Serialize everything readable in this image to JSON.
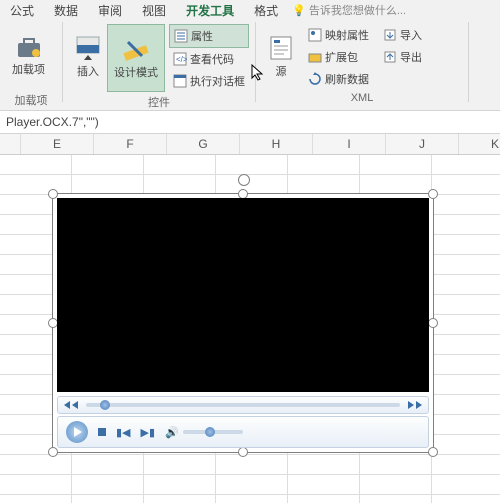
{
  "tabs": {
    "t0": "公式",
    "t1": "数据",
    "t2": "审阅",
    "t3": "视图",
    "t4": "开发工具",
    "t5": "格式"
  },
  "tell": "告诉我您想做什么...",
  "groups": {
    "addins": {
      "label": "加载项",
      "btn": "加载项"
    },
    "controls": {
      "label": "控件",
      "insert": "插入",
      "design": "设计模式",
      "props": "属性",
      "code": "查看代码",
      "dialog": "执行对话框"
    },
    "xml": {
      "label": "XML",
      "source": "源",
      "map": "映射属性",
      "ext": "扩展包",
      "refresh": "刷新数据",
      "imp": "导入",
      "exp": "导出"
    }
  },
  "formula": "Player.OCX.7\",\"\")",
  "cols": [
    "E",
    "F",
    "G",
    "H",
    "I",
    "J",
    "K"
  ]
}
